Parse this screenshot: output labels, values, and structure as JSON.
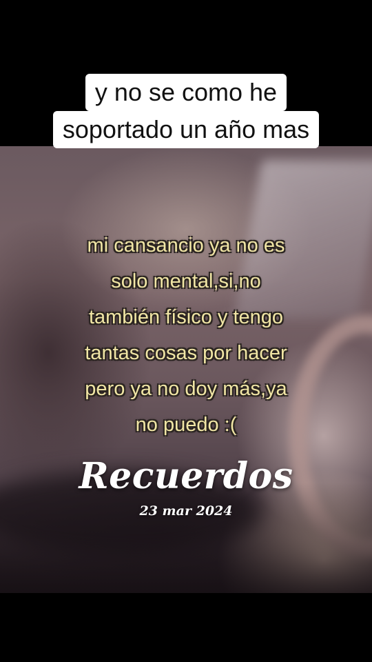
{
  "caption": {
    "line1": "y no se como he",
    "line2": "soportado un año mas"
  },
  "overlay": {
    "lines": [
      "mi cansancio ya no es",
      "solo mental,si,no",
      "también físico y tengo",
      "tantas cosas por hacer",
      "pero ya no doy más,ya",
      "no puedo :("
    ],
    "color": "#f1e6a5"
  },
  "stamp": {
    "title": "Recuerdos",
    "date": "23 mar 2024"
  }
}
